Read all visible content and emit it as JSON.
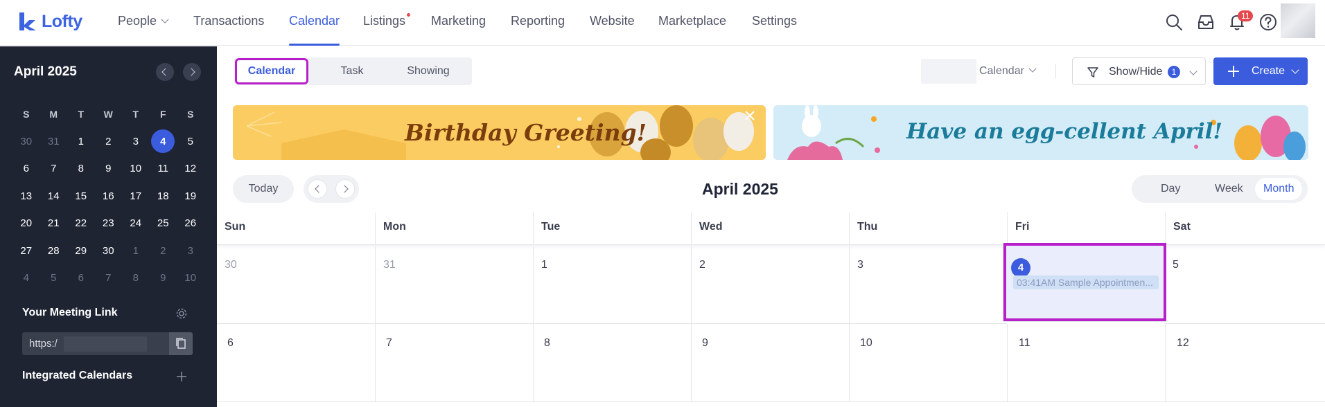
{
  "app": {
    "logo_text": "Lofty",
    "brand_color": "#3b5ddd",
    "highlight_color": "#b720c8"
  },
  "nav": {
    "items": [
      {
        "label": "People"
      },
      {
        "label": "Transactions"
      },
      {
        "label": "Calendar"
      },
      {
        "label": "Listings"
      },
      {
        "label": "Marketing"
      },
      {
        "label": "Reporting"
      },
      {
        "label": "Website"
      },
      {
        "label": "Marketplace"
      },
      {
        "label": "Settings"
      }
    ],
    "active": "Calendar",
    "notification_count": "11",
    "icons": [
      "search-icon",
      "inbox-icon",
      "bell-icon",
      "help-icon"
    ]
  },
  "sidebar": {
    "month_title": "April 2025",
    "weekdays": [
      "S",
      "M",
      "T",
      "W",
      "T",
      "F",
      "S"
    ],
    "weeks": [
      [
        "30",
        "31",
        "1",
        "2",
        "3",
        "4",
        "5"
      ],
      [
        "6",
        "7",
        "8",
        "9",
        "10",
        "11",
        "12"
      ],
      [
        "13",
        "14",
        "15",
        "16",
        "17",
        "18",
        "19"
      ],
      [
        "20",
        "21",
        "22",
        "23",
        "24",
        "25",
        "26"
      ],
      [
        "27",
        "28",
        "29",
        "30",
        "1",
        "2",
        "3"
      ],
      [
        "4",
        "5",
        "6",
        "7",
        "8",
        "9",
        "10"
      ]
    ],
    "selected_day": "4",
    "meeting_link_title": "Your Meeting Link",
    "meeting_link_value": "https:/",
    "integrated_calendars_title": "Integrated Calendars"
  },
  "main": {
    "tabs": [
      "Calendar",
      "Task",
      "Showing"
    ],
    "active_tab": "Calendar",
    "calendar_select": "Calendar",
    "show_hide_label": "Show/Hide",
    "show_hide_count": "1",
    "create_label": "Create",
    "banners": [
      "Birthday Greeting!",
      "Have an egg-cellent April!"
    ],
    "today_label": "Today",
    "month_title": "April 2025",
    "views": [
      "Day",
      "Week",
      "Month"
    ],
    "active_view": "Month",
    "weekdays": [
      "Sun",
      "Mon",
      "Tue",
      "Wed",
      "Thu",
      "Fri",
      "Sat"
    ],
    "week1": [
      "30",
      "31",
      "1",
      "2",
      "3",
      "4",
      "5"
    ],
    "week2": [
      "6",
      "7",
      "8",
      "9",
      "10",
      "11",
      "12"
    ],
    "event": {
      "text": "03:41AM Sample Appointmen..."
    }
  }
}
